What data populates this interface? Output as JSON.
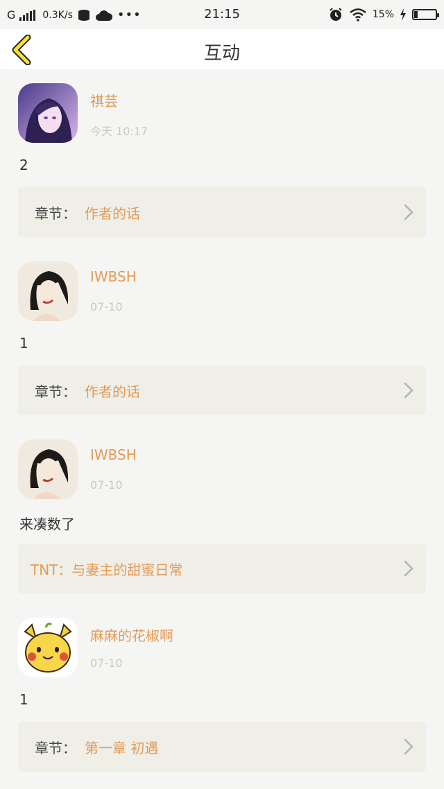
{
  "status": {
    "carrier": "G",
    "speed": "0.3K/s",
    "time": "21:15",
    "battery": "15%",
    "battery_level": 0.15
  },
  "header": {
    "title": "互动"
  },
  "accent_color": "#e49a56",
  "items": [
    {
      "user": "祺芸",
      "time": "今天 10:17",
      "content": "2",
      "chapter_label": "章节：",
      "chapter_value": "作者的话",
      "avatar": "anime-girl-avatar"
    },
    {
      "user": "IWBSH",
      "time": "07-10",
      "content": "1",
      "chapter_label": "章节：",
      "chapter_value": "作者的话",
      "avatar": "sketch-girl-avatar"
    },
    {
      "user": "IWBSH",
      "time": "07-10",
      "content": "来凑数了",
      "chapter_label": "",
      "chapter_value": "TNT：与妻主的甜蜜日常",
      "avatar": "sketch-girl-avatar"
    },
    {
      "user": "麻麻的花椒啊",
      "time": "07-10",
      "content": "1",
      "chapter_label": "章节：",
      "chapter_value": "第一章 初遇",
      "avatar": "pikachu-avatar"
    }
  ]
}
